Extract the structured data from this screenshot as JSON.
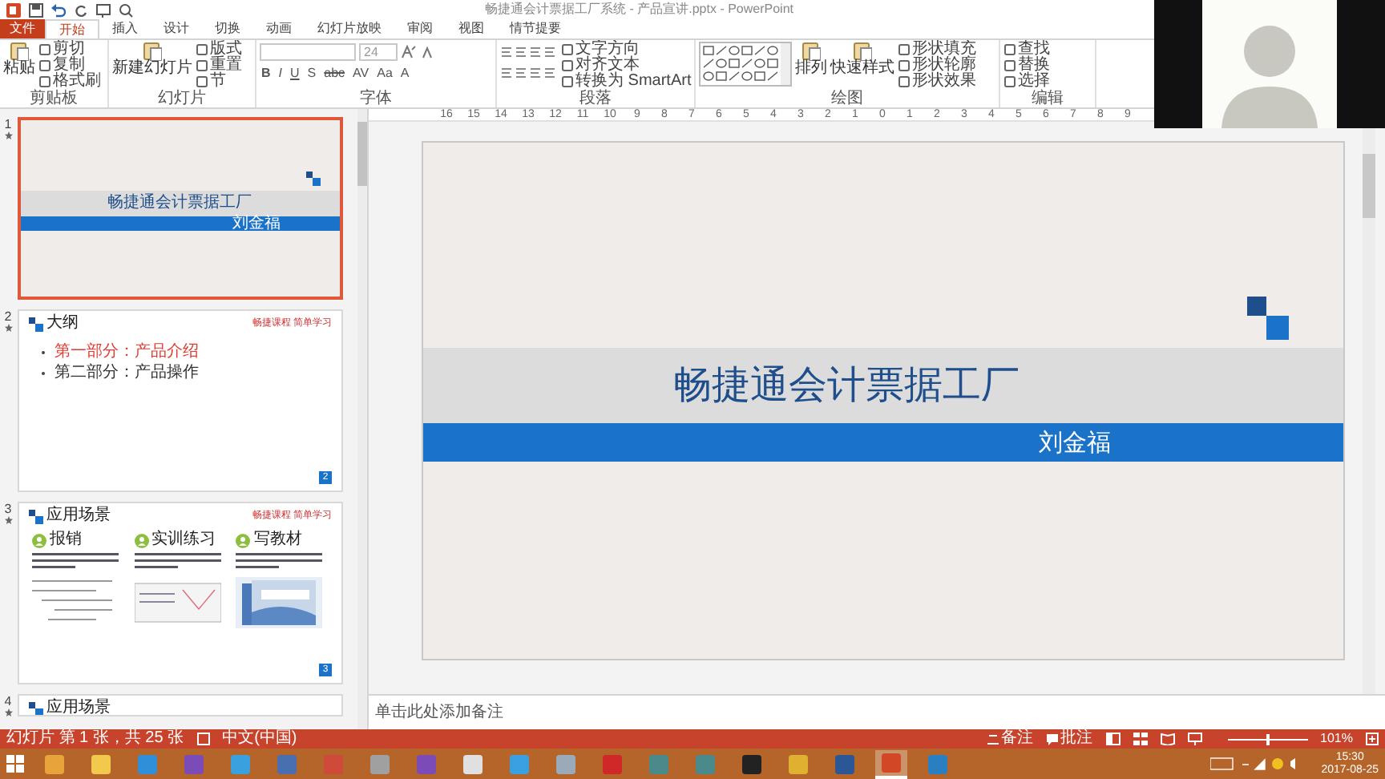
{
  "window": {
    "title": "畅捷通会计票据工厂系统 - 产品宣讲.pptx - PowerPoint"
  },
  "tabs": [
    {
      "label": "文件",
      "kind": "file",
      "selected": false
    },
    {
      "label": "开始",
      "kind": "tab",
      "selected": true
    },
    {
      "label": "插入",
      "kind": "tab",
      "selected": false
    },
    {
      "label": "设计",
      "kind": "tab",
      "selected": false
    },
    {
      "label": "切换",
      "kind": "tab",
      "selected": false
    },
    {
      "label": "动画",
      "kind": "tab",
      "selected": false
    },
    {
      "label": "幻灯片放映",
      "kind": "tab",
      "selected": false
    },
    {
      "label": "审阅",
      "kind": "tab",
      "selected": false
    },
    {
      "label": "视图",
      "kind": "tab",
      "selected": false
    },
    {
      "label": "情节提要",
      "kind": "tab",
      "selected": false
    }
  ],
  "ribbon": {
    "groups": [
      {
        "label": "剪贴板",
        "kind": "clipboard",
        "large": [
          "粘贴"
        ],
        "small": [
          "剪切",
          "复制",
          "格式刷"
        ]
      },
      {
        "label": "幻灯片",
        "kind": "slides",
        "large": [
          "新建幻灯片"
        ],
        "small": [
          "版式",
          "重置",
          "节"
        ]
      },
      {
        "label": "字体",
        "kind": "font",
        "size": "24",
        "formats": [
          "B",
          "I",
          "U",
          "S",
          "abc",
          "AV",
          "Aa",
          "A"
        ]
      },
      {
        "label": "段落",
        "kind": "paragraph",
        "small": [
          "文字方向",
          "对齐文本",
          "转换为 SmartArt"
        ]
      },
      {
        "label": "绘图",
        "kind": "drawing",
        "large": [
          "排列",
          "快速样式"
        ],
        "small": [
          "形状填充",
          "形状轮廓",
          "形状效果"
        ]
      },
      {
        "label": "编辑",
        "kind": "editing",
        "small": [
          "查找",
          "替换",
          "选择"
        ]
      }
    ]
  },
  "slides": [
    {
      "number": "1",
      "kind": "title",
      "title": "畅捷通会计票据工厂",
      "subtitle": "刘金福",
      "selected": true
    },
    {
      "number": "2",
      "kind": "outline",
      "title": "大纲",
      "tag": "畅捷课程 简单学习",
      "bullets": [
        {
          "text": "第一部分：产品介绍",
          "color": "#e03c31"
        },
        {
          "text": "第二部分：产品操作",
          "color": "#333333"
        }
      ],
      "page": "2",
      "selected": false
    },
    {
      "number": "3",
      "kind": "scenes",
      "title": "应用场景",
      "tag": "畅捷课程 简单学习",
      "columns": [
        {
          "heading": "报销"
        },
        {
          "heading": "实训练习"
        },
        {
          "heading": "写教材"
        }
      ],
      "page": "3",
      "selected": false
    },
    {
      "number": "4",
      "kind": "partial",
      "title": "应用场景",
      "selected": false
    }
  ],
  "ruler": {
    "ticks": [
      "16",
      "15",
      "14",
      "13",
      "12",
      "11",
      "10",
      "9",
      "8",
      "7",
      "6",
      "5",
      "4",
      "3",
      "2",
      "1",
      "0",
      "1",
      "2",
      "3",
      "4",
      "5",
      "6",
      "7",
      "8",
      "9"
    ]
  },
  "editor": {
    "title": "畅捷通会计票据工厂",
    "subtitle": "刘金福"
  },
  "notes": {
    "placeholder": "单击此处添加备注"
  },
  "status_bar": {
    "slide_info": "幻灯片 第 1 张，共 25 张",
    "language": "中文(中国)",
    "notes": "备注",
    "comments": "批注",
    "zoom": "101%",
    "zoom_slider": {
      "level": 0.5
    }
  },
  "taskbar": {
    "apps": [
      {
        "color": "#e8a33a",
        "active": false
      },
      {
        "color": "#f2c94c",
        "active": false
      },
      {
        "color": "#2f8fd8",
        "active": false
      },
      {
        "color": "#7b4bb8",
        "active": false
      },
      {
        "color": "#3aa0e0",
        "active": false
      },
      {
        "color": "#4a6fb0",
        "active": false
      },
      {
        "color": "#d04a3a",
        "active": false
      },
      {
        "color": "#a0a0a0",
        "active": false
      },
      {
        "color": "#7b4bb8",
        "active": false
      },
      {
        "color": "#e0e0e0",
        "active": false
      },
      {
        "color": "#3aa0e0",
        "active": false
      },
      {
        "color": "#9aaab8",
        "active": false
      },
      {
        "color": "#d02828",
        "active": false
      },
      {
        "color": "#4a8a8a",
        "active": false
      },
      {
        "color": "#4a8a8a",
        "active": false
      },
      {
        "color": "#222222",
        "active": false
      },
      {
        "color": "#e0b030",
        "active": false
      },
      {
        "color": "#2b5797",
        "active": false
      },
      {
        "color": "#d24726",
        "active": true
      },
      {
        "color": "#2a7fc0",
        "active": false
      }
    ],
    "time": "15:30",
    "date": "2017-08-25"
  }
}
